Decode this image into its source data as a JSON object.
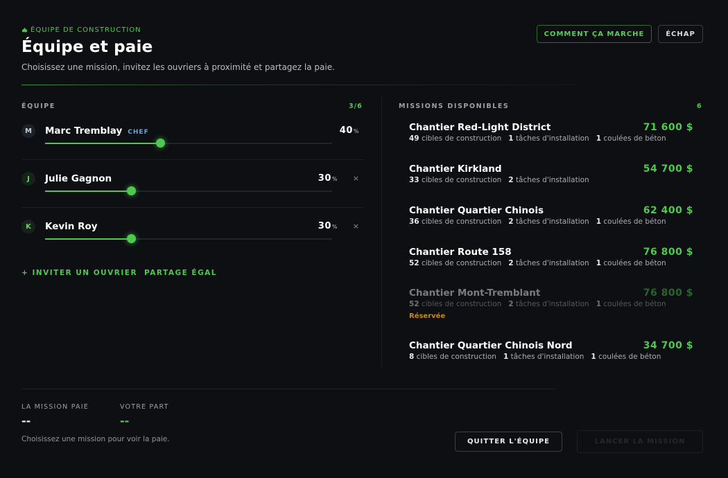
{
  "header": {
    "kicker": "ÉQUIPE DE CONSTRUCTION",
    "title": "Équipe et paie",
    "subtitle": "Choisissez une mission, invitez les ouvriers à proximité et partagez la paie.",
    "how_it_works_label": "COMMENT ÇA MARCHE",
    "escape_label": "ÉCHAP"
  },
  "team": {
    "section_label": "ÉQUIPE",
    "count": "3/6",
    "members": [
      {
        "initial": "M",
        "name": "Marc Tremblay",
        "badge": "CHEF",
        "percent": "40",
        "percent_unit": "%",
        "share": 0.4,
        "removable": false
      },
      {
        "initial": "J",
        "name": "Julie Gagnon",
        "badge": "",
        "percent": "30",
        "percent_unit": "%",
        "share": 0.3,
        "removable": true,
        "remove_glyph": "×"
      },
      {
        "initial": "K",
        "name": "Kevin Roy",
        "badge": "",
        "percent": "30",
        "percent_unit": "%",
        "share": 0.3,
        "removable": true,
        "remove_glyph": "×"
      }
    ],
    "invite_label": "+ INVITER UN OUVRIER",
    "equal_split_label": "PARTAGE ÉGAL"
  },
  "missions": {
    "section_label": "MISSIONS DISPONIBLES",
    "count": "6",
    "items": [
      {
        "name": "Chantier Red-Light District",
        "price": "71 600 $",
        "targets": "49",
        "targets_label": "cibles de construction",
        "installs": "1",
        "installs_label": "tâches d'installation",
        "pours": "1",
        "pours_label": "coulées de béton",
        "reserved": false
      },
      {
        "name": "Chantier Kirkland",
        "price": "54 700 $",
        "targets": "33",
        "targets_label": "cibles de construction",
        "installs": "2",
        "installs_label": "tâches d'installation",
        "pours": "",
        "pours_label": "",
        "reserved": false
      },
      {
        "name": "Chantier Quartier Chinois",
        "price": "62 400 $",
        "targets": "36",
        "targets_label": "cibles de construction",
        "installs": "2",
        "installs_label": "tâches d'installation",
        "pours": "1",
        "pours_label": "coulées de béton",
        "reserved": false
      },
      {
        "name": "Chantier Route 158",
        "price": "76 800 $",
        "targets": "52",
        "targets_label": "cibles de construction",
        "installs": "2",
        "installs_label": "tâches d'installation",
        "pours": "1",
        "pours_label": "coulées de béton",
        "reserved": false
      },
      {
        "name": "Chantier Mont-Tremblant",
        "price": "76 800 $",
        "targets": "52",
        "targets_label": "cibles de construction",
        "installs": "2",
        "installs_label": "tâches d'installation",
        "pours": "1",
        "pours_label": "coulées de béton",
        "reserved": true,
        "reserved_label": "Réservée"
      },
      {
        "name": "Chantier Quartier Chinois Nord",
        "price": "34 700 $",
        "targets": "8",
        "targets_label": "cibles de construction",
        "installs": "1",
        "installs_label": "tâches d'installation",
        "pours": "1",
        "pours_label": "coulées de béton",
        "reserved": false
      }
    ]
  },
  "footer": {
    "mission_pay_label": "LA MISSION PAIE",
    "mission_pay_value": "--",
    "your_share_label": "VOTRE PART",
    "your_share_value": "--",
    "hint": "Choisissez une mission pour voir la paie.",
    "quit_label": "QUITTER L'ÉQUIPE",
    "confirm_label": "LANCER LA MISSION"
  },
  "colors": {
    "accent": "#4ec94e",
    "background": "#0d0f12",
    "chef_badge": "#5fa8e8",
    "reserved": "#c28a1e"
  }
}
